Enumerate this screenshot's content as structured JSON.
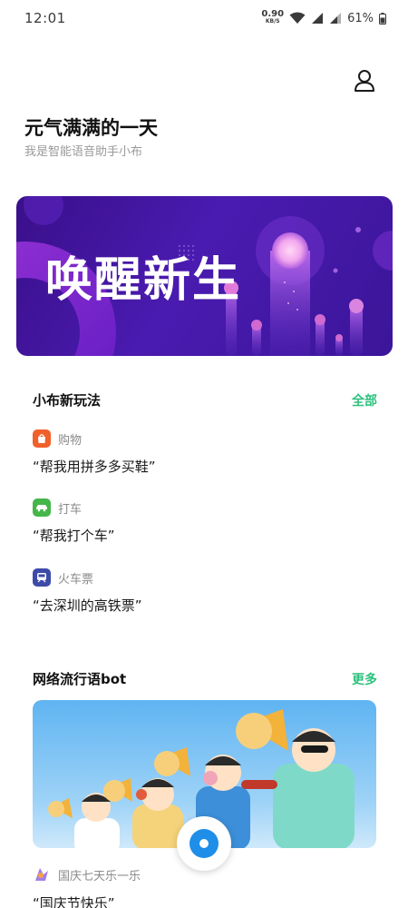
{
  "status_bar": {
    "time": "12:01",
    "net_speed_value": "0.90",
    "net_speed_unit": "KB/S",
    "battery": "61%",
    "icons": [
      "wifi-icon",
      "signal-icon",
      "signal-icon",
      "battery-icon"
    ]
  },
  "header": {
    "title": "元气满满的一天",
    "subtitle": "我是智能语音助手小布",
    "profile_icon": "user-icon"
  },
  "banner": {
    "text": "唤醒新生"
  },
  "skills_section": {
    "title": "小布新玩法",
    "more_label": "全部",
    "items": [
      {
        "category": "购物",
        "phrase": "“帮我用拼多多买鞋”",
        "icon": "shopping-bag-icon",
        "color": "#f0602a"
      },
      {
        "category": "打车",
        "phrase": "“帮我打个车”",
        "icon": "car-icon",
        "color": "#45b649"
      },
      {
        "category": "火车票",
        "phrase": "“去深圳的高铁票”",
        "icon": "train-icon",
        "color": "#3d4ba8"
      }
    ]
  },
  "meme_section": {
    "title": "网络流行语bot",
    "more_label": "更多",
    "card_category": "国庆七天乐一乐",
    "card_phrase": "“国庆节快乐”",
    "card_icon": "meme-logo-icon"
  },
  "voice_button": {
    "icon": "voice-assistant-icon",
    "color": "#1e8ee8"
  },
  "colors": {
    "accent_green": "#2ec27e",
    "banner_purple": "#4a1bb0"
  }
}
